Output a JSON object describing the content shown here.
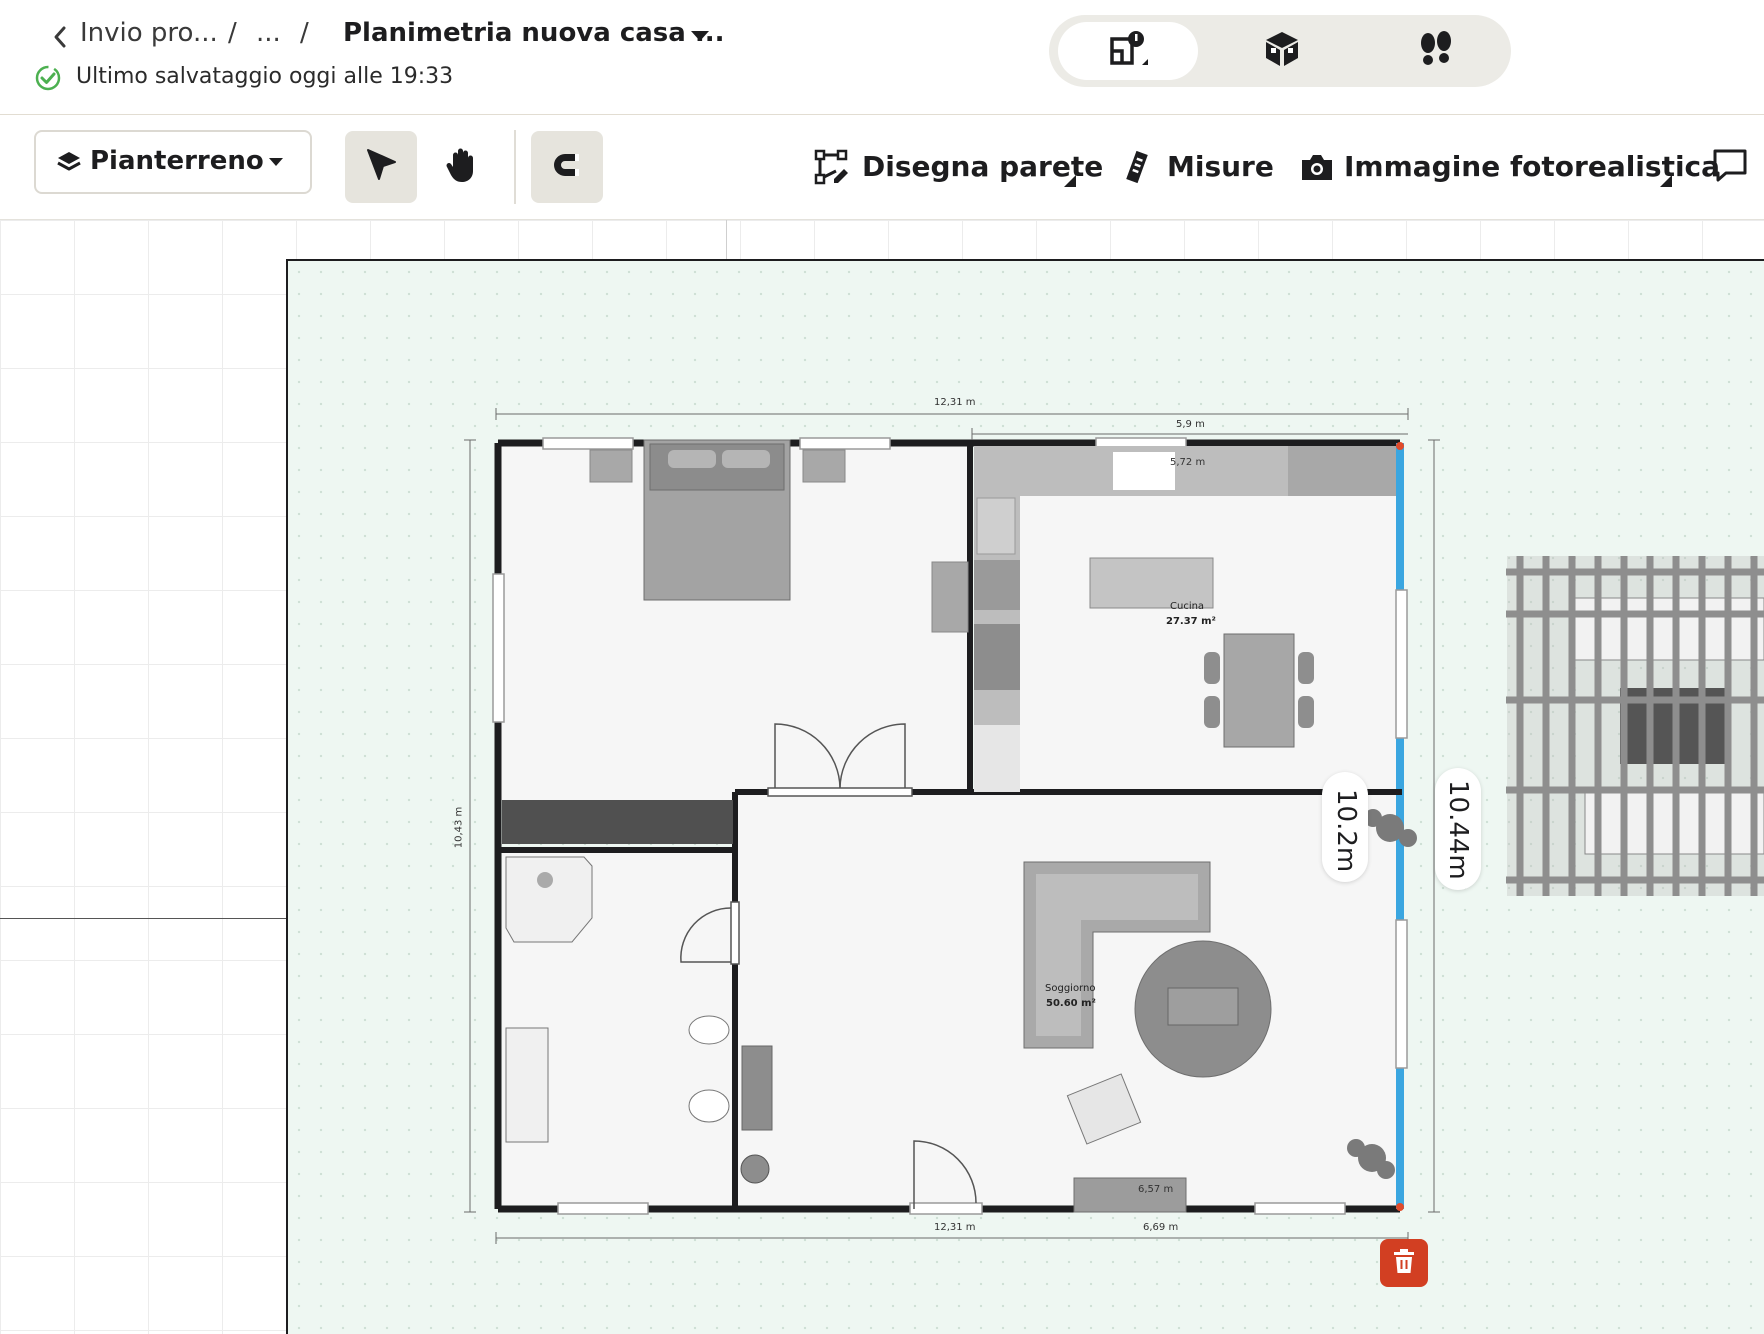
{
  "header": {
    "back_label": "Invio pro...",
    "separator": "/",
    "ellipsis": "...",
    "project_title": "Planimetria nuova casa ...",
    "save_status": "Ultimo salvataggio oggi alle 19:33",
    "view_modes": [
      {
        "name": "2d-plan",
        "icon": "floorplan-icon"
      },
      {
        "name": "3d-view",
        "icon": "cube-icon"
      },
      {
        "name": "walkthrough",
        "icon": "footprints-icon"
      }
    ]
  },
  "toolbar": {
    "floor": "Pianterreno",
    "draw_wall": "Disegna parete",
    "measures": "Misure",
    "photo_render": "Immagine fotorealistica"
  },
  "plan": {
    "dim_total_top": "12,31 m",
    "dim_kitchen_top": "5,9 m",
    "dim_kitchen_inner": "5,72 m",
    "dim_left": "10,43 m",
    "dim_bottom_left": "12,31 m",
    "dim_bottom_right": "6,69 m",
    "dim_bottom_inner": "6,57 m",
    "wall_length_inner": "10.2m",
    "wall_length_outer": "10.44m",
    "rooms": [
      {
        "name": "Cucina",
        "area": "27.37 m²"
      },
      {
        "name": "Soggiorno",
        "area": "50.60 m²"
      }
    ],
    "accent_color": "#3aa6e0",
    "delete_color": "#d23f22"
  }
}
